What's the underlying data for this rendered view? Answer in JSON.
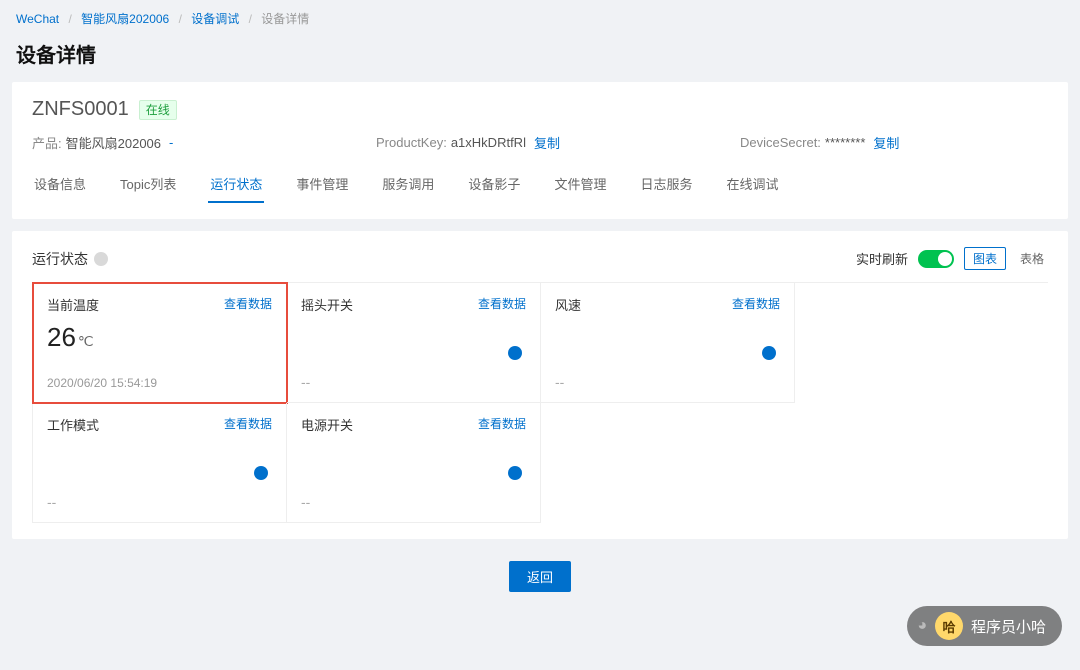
{
  "breadcrumb": {
    "items": [
      "WeChat",
      "智能风扇202006",
      "设备调试",
      "设备详情"
    ]
  },
  "page_title": "设备详情",
  "device": {
    "name": "ZNFS0001",
    "status_label": "在线",
    "product_label": "产品:",
    "product_value": "智能风扇202006",
    "product_suffix": "-",
    "pk_label": "ProductKey:",
    "pk_value": "a1xHkDRtfRl",
    "pk_copy": "复制",
    "ds_label": "DeviceSecret:",
    "ds_value": "********",
    "ds_copy": "复制"
  },
  "tabs": [
    "设备信息",
    "Topic列表",
    "运行状态",
    "事件管理",
    "服务调用",
    "设备影子",
    "文件管理",
    "日志服务",
    "在线调试"
  ],
  "tabs_active_index": 2,
  "status": {
    "title": "运行状态",
    "refresh_label": "实时刷新",
    "chart_btn": "图表",
    "table_btn": "表格",
    "view_label": "查看数据",
    "tiles": [
      {
        "title": "当前温度",
        "value": "26",
        "unit": "℃",
        "timestamp": "2020/06/20 15:54:19",
        "highlight": true,
        "info": false
      },
      {
        "title": "摇头开关",
        "value": "--",
        "unit": "",
        "timestamp": "",
        "highlight": false,
        "info": true
      },
      {
        "title": "风速",
        "value": "--",
        "unit": "",
        "timestamp": "",
        "highlight": false,
        "info": true
      },
      {
        "title": "工作模式",
        "value": "--",
        "unit": "",
        "timestamp": "",
        "highlight": false,
        "info": true
      },
      {
        "title": "电源开关",
        "value": "--",
        "unit": "",
        "timestamp": "",
        "highlight": false,
        "info": true
      }
    ]
  },
  "back_button": "返回",
  "channel_name": "程序员小哈",
  "channel_icon": "哈"
}
